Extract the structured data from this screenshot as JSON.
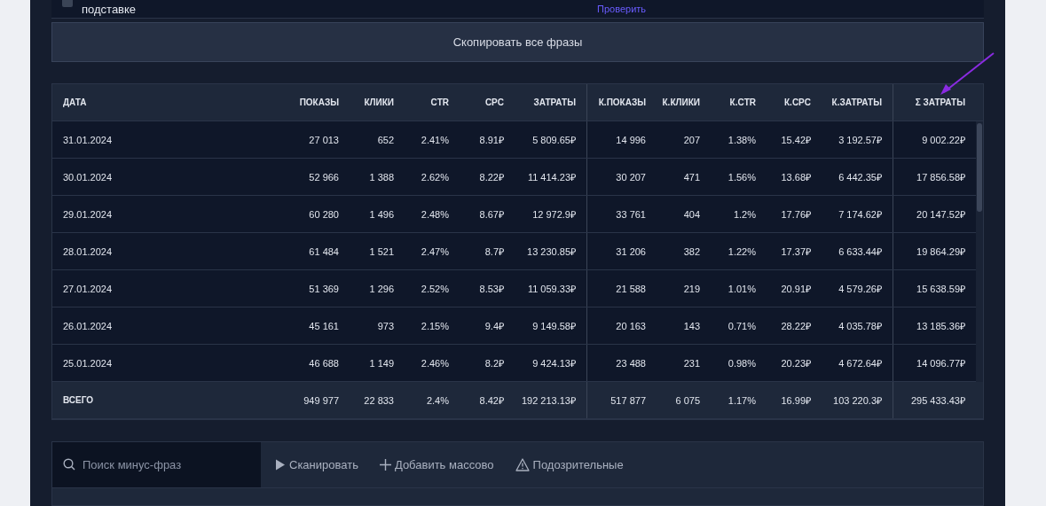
{
  "phrase_row": {
    "checked": false,
    "phrase": "подставке",
    "link": "Проверить"
  },
  "copy_button": "Скопировать все фразы",
  "table": {
    "columns": [
      "ДАТА",
      "ПОКАЗЫ",
      "КЛИКИ",
      "CTR",
      "CPC",
      "ЗАТРАТЫ",
      "К.ПОКАЗЫ",
      "К.КЛИКИ",
      "К.CTR",
      "К.CPC",
      "К.ЗАТРАТЫ",
      "Σ ЗАТРАТЫ"
    ],
    "rows": [
      [
        "31.01.2024",
        "27 013",
        "652",
        "2.41%",
        "8.91₽",
        "5 809.65₽",
        "14 996",
        "207",
        "1.38%",
        "15.42₽",
        "3 192.57₽",
        "9 002.22₽"
      ],
      [
        "30.01.2024",
        "52 966",
        "1 388",
        "2.62%",
        "8.22₽",
        "11 414.23₽",
        "30 207",
        "471",
        "1.56%",
        "13.68₽",
        "6 442.35₽",
        "17 856.58₽"
      ],
      [
        "29.01.2024",
        "60 280",
        "1 496",
        "2.48%",
        "8.67₽",
        "12 972.9₽",
        "33 761",
        "404",
        "1.2%",
        "17.76₽",
        "7 174.62₽",
        "20 147.52₽"
      ],
      [
        "28.01.2024",
        "61 484",
        "1 521",
        "2.47%",
        "8.7₽",
        "13 230.85₽",
        "31 206",
        "382",
        "1.22%",
        "17.37₽",
        "6 633.44₽",
        "19 864.29₽"
      ],
      [
        "27.01.2024",
        "51 369",
        "1 296",
        "2.52%",
        "8.53₽",
        "11 059.33₽",
        "21 588",
        "219",
        "1.01%",
        "20.91₽",
        "4 579.26₽",
        "15 638.59₽"
      ],
      [
        "26.01.2024",
        "45 161",
        "973",
        "2.15%",
        "9.4₽",
        "9 149.58₽",
        "20 163",
        "143",
        "0.71%",
        "28.22₽",
        "4 035.78₽",
        "13 185.36₽"
      ],
      [
        "25.01.2024",
        "46 688",
        "1 149",
        "2.46%",
        "8.2₽",
        "9 424.13₽",
        "23 488",
        "231",
        "0.98%",
        "20.23₽",
        "4 672.64₽",
        "14 096.77₽"
      ]
    ],
    "total": [
      "ВСЕГО",
      "949 977",
      "22 833",
      "2.4%",
      "8.42₽",
      "192 213.13₽",
      "517 877",
      "6 075",
      "1.17%",
      "16.99₽",
      "103 220.3₽",
      "295 433.43₽"
    ]
  },
  "toolbar": {
    "search": {
      "placeholder": "Поиск минус-фраз"
    },
    "buttons": [
      {
        "kind": "scan",
        "label": "Сканировать"
      },
      {
        "kind": "add",
        "label": "Добавить массово"
      },
      {
        "kind": "suspicious",
        "label": "Подозрительные"
      }
    ]
  }
}
